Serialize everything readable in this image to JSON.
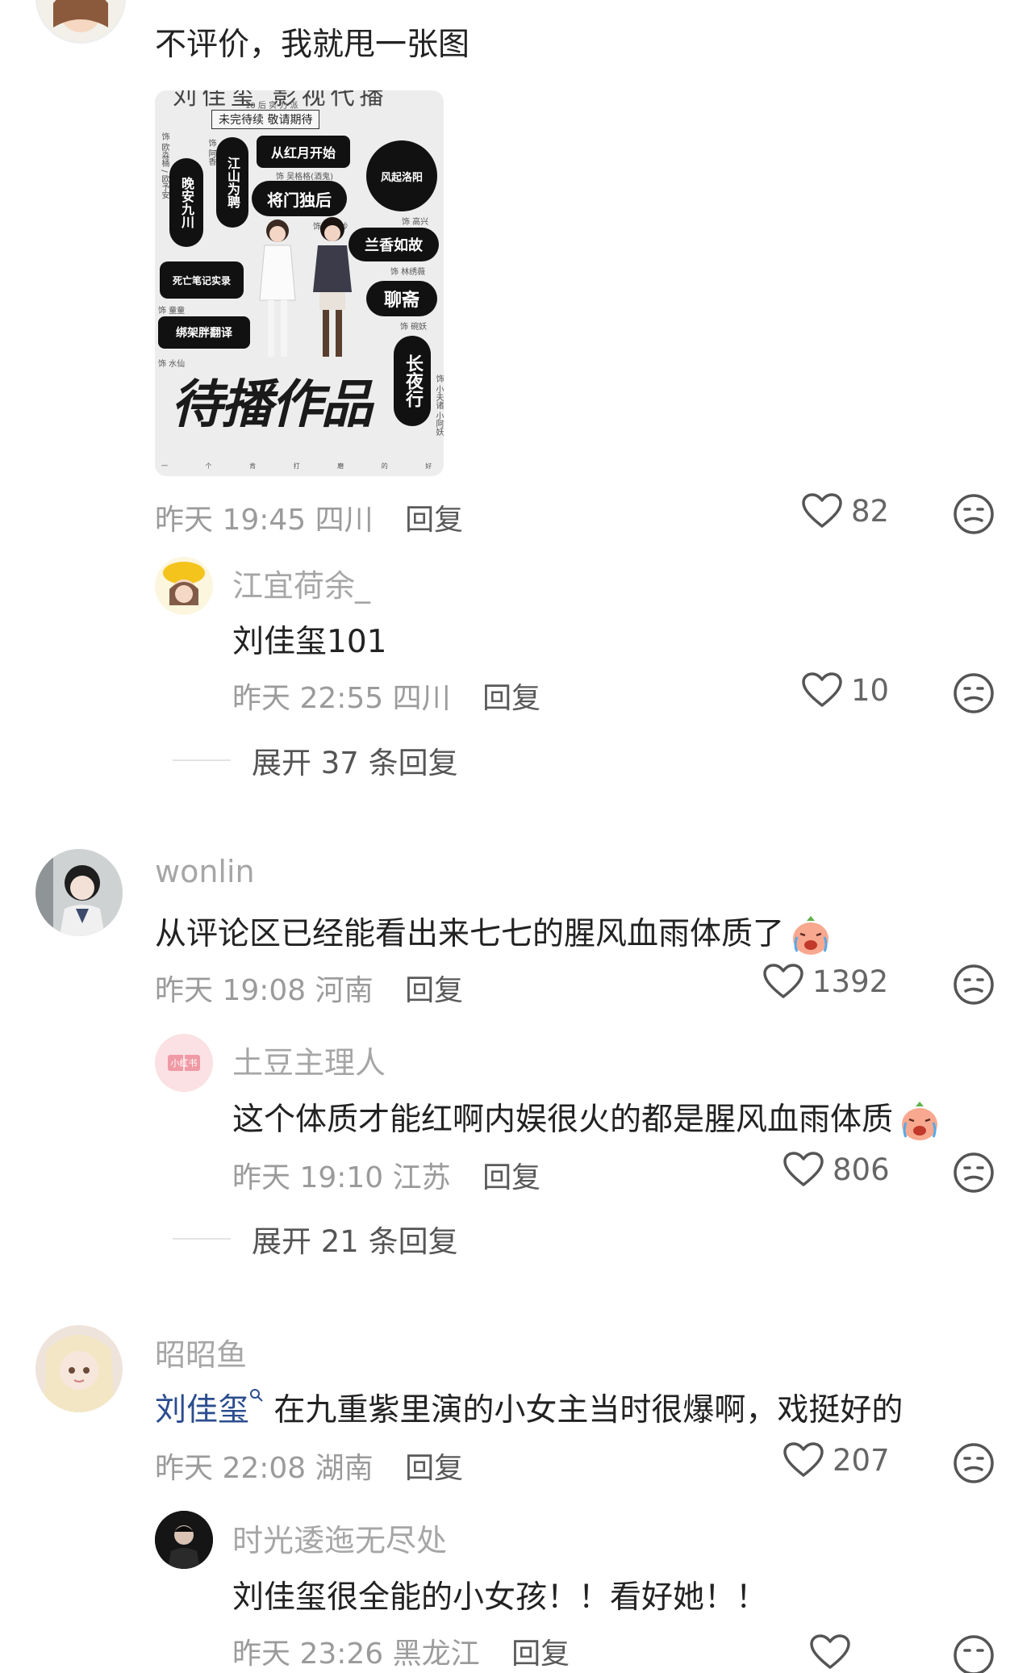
{
  "comments": [
    {
      "text": "不评价，我就甩一张图",
      "time": "昨天 19:45",
      "location": "四川",
      "reply_label": "回复",
      "likes": "82",
      "image": {
        "top_title": "刘佳玺 影视代播",
        "subtitle": "未完待续  敬请期待",
        "top_small": "10 后 实 力 派",
        "works": [
          "从红月开始",
          "江山为聘",
          "将门独后",
          "风起洛阳",
          "兰香如故",
          "死亡笔记实录",
          "聊斋",
          "绑架胖翻译",
          "长夜行",
          "晚安九川"
        ],
        "roles": [
          "饰 欧淼桶 / 欧予安",
          "饰 阿香",
          "饰 吴格格(酒鬼)",
          "饰 小沈妙",
          "饰 高兴",
          "饰 林绣薇",
          "饰 童童",
          "饰 碗妖",
          "饰 水仙",
          "饰 小夫诸 小阿妖"
        ],
        "big_text": "待播作品",
        "footer": "一 个 肯 打 磨 的 好 演 员"
      },
      "replies": [
        {
          "name": "江宜荷余_",
          "text": "刘佳玺101",
          "time": "昨天 22:55",
          "location": "四川",
          "reply_label": "回复",
          "likes": "10"
        }
      ],
      "expand": "展开 37 条回复"
    },
    {
      "name": "wonlin",
      "text": "从评论区已经能看出来七七的腥风血雨体质了",
      "time": "昨天 19:08",
      "location": "河南",
      "reply_label": "回复",
      "likes": "1392",
      "replies": [
        {
          "name": "土豆主理人",
          "avatar_text": "小红书",
          "text": "这个体质才能红啊内娱很火的都是腥风血雨体质",
          "time": "昨天 19:10",
          "location": "江苏",
          "reply_label": "回复",
          "likes": "806"
        }
      ],
      "expand": "展开 21 条回复"
    },
    {
      "name": "昭昭鱼",
      "mention": "刘佳玺",
      "text": " 在九重紫里演的小女主当时很爆啊，戏挺好的",
      "time": "昨天 22:08",
      "location": "湖南",
      "reply_label": "回复",
      "likes": "207",
      "replies": [
        {
          "name": "时光逶迤无尽处",
          "text": "刘佳玺很全能的小女孩！！看好她！！",
          "time": "昨天 23:26",
          "location": "黑龙江",
          "reply_label": "回复"
        }
      ]
    }
  ],
  "colors": {
    "mention": "#2b4d8f",
    "meta": "#9b9b9b",
    "name": "#a6a6a6"
  },
  "icons": [
    "heart-outline-icon",
    "dislike-face-icon",
    "crying-emoji-icon",
    "search-mention-icon"
  ]
}
